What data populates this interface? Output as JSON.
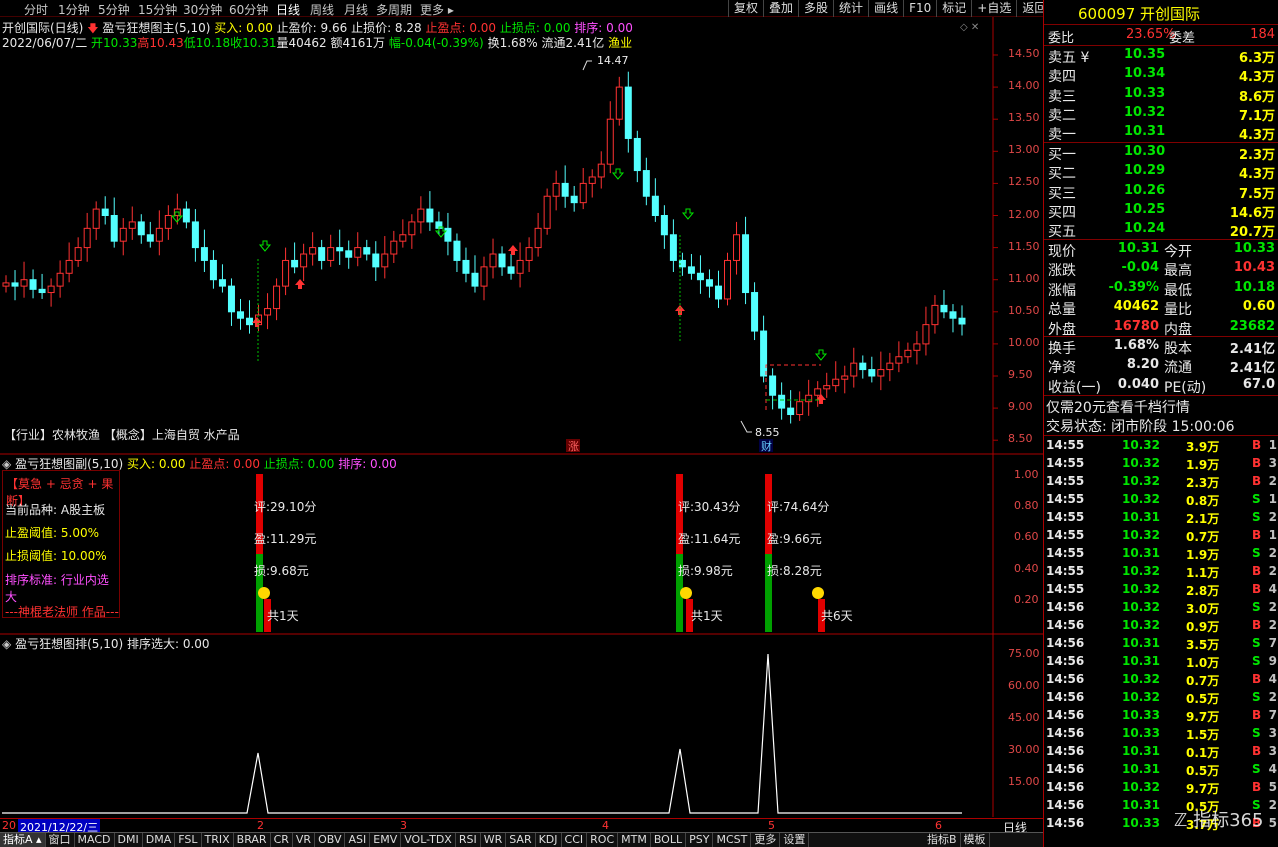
{
  "topbar": {
    "periods": [
      "分时",
      "1分钟",
      "5分钟",
      "15分钟",
      "30分钟",
      "60分钟",
      "日线",
      "周线",
      "月线",
      "多周期",
      "更多"
    ],
    "active": "日线",
    "right_buttons": [
      "复权",
      "叠加",
      "多股",
      "统计",
      "画线",
      "F10",
      "标记",
      "+自选",
      "返回"
    ]
  },
  "main_info": {
    "title": "开创国际(日线)",
    "indicator": "盈亏狂想图主(5,10)",
    "buy": "买入: 0.00",
    "take_profit_price": "止盈价: 9.66",
    "stop_loss_price": "止损价: 8.28",
    "take_profit_point": "止盈点: 0.00",
    "stop_loss_point": "止损点: 0.00",
    "rank": "排序: 0.00",
    "date": "2022/06/07/二",
    "open": "开10.33",
    "high": "高10.43",
    "low": "低10.18",
    "close": "收10.31",
    "volume": "量40462",
    "amount": "额4161万",
    "change": "幅-0.04(-0.39%)",
    "turnover": "换1.68%",
    "float": "流通2.41亿",
    "sector": "渔业",
    "industry_line": "【行业】农林牧渔 【概念】上海自贸 水产品",
    "max_label": "14.47",
    "min_label": "8.55",
    "mark_zhang": "涨",
    "mark_cai": "财"
  },
  "main_axis": [
    "14.50",
    "14.00",
    "13.50",
    "13.00",
    "12.50",
    "12.00",
    "11.50",
    "11.00",
    "10.50",
    "10.00",
    "9.50",
    "9.00",
    "8.50"
  ],
  "sub1": {
    "title": "盈亏狂想图副(5,10)",
    "buy": "买入: 0.00",
    "tp": "止盈点: 0.00",
    "sl": "止损点: 0.00",
    "rank": "排序: 0.00",
    "box_title": "【莫急 + 忌贪 + 果断】",
    "variety_label": "当前品种:",
    "variety_value": "A股主板",
    "tp_threshold_label": "止盈阈值:",
    "tp_threshold_value": "5.00%",
    "sl_threshold_label": "止损阈值:",
    "sl_threshold_value": "10.00%",
    "rank_std_label": "排序标准:",
    "rank_std_value": "行业内选大",
    "author": "---神棍老法师 作品---",
    "signals": [
      {
        "score": "评:29.10分",
        "profit": "盈:11.29元",
        "loss": "损:9.68元",
        "days": "共1天"
      },
      {
        "score": "评:30.43分",
        "profit": "盈:11.64元",
        "loss": "损:9.98元",
        "days": "共1天"
      },
      {
        "score": "评:74.64分",
        "profit": "盈:9.66元",
        "loss": "损:8.28元",
        "days": "共6天"
      }
    ],
    "axis": [
      "1.00",
      "0.80",
      "0.60",
      "0.40",
      "0.20"
    ]
  },
  "sub2": {
    "title": "盈亏狂想图排(5,10)",
    "rank": "排序选大: 0.00",
    "axis": [
      "75.00",
      "60.00",
      "45.00",
      "30.00",
      "15.00"
    ]
  },
  "xaxis": {
    "date_label": "2021/12/22/三",
    "prefix": "20",
    "months": [
      "2",
      "3",
      "4",
      "5",
      "6"
    ],
    "period": "日线"
  },
  "bottom_tabs": [
    "指标A",
    "窗口",
    "MACD",
    "DMI",
    "DMA",
    "FSL",
    "TRIX",
    "BRAR",
    "CR",
    "VR",
    "OBV",
    "ASI",
    "EMV",
    "VOL-TDX",
    "RSI",
    "WR",
    "SAR",
    "KDJ",
    "CCI",
    "ROC",
    "MTM",
    "BOLL",
    "PSY",
    "MCST",
    "更多",
    "设置"
  ],
  "bottom_right": [
    "指标B",
    "模板"
  ],
  "quote": {
    "code": "600097",
    "name": "开创国际",
    "weibi_label": "委比",
    "weibi": "23.65%",
    "weicha_label": "委差",
    "weicha": "184",
    "sells": [
      {
        "label": "卖五",
        "price": "10.35",
        "vol": "6.3万",
        "mark": "¥"
      },
      {
        "label": "卖四",
        "price": "10.34",
        "vol": "4.3万"
      },
      {
        "label": "卖三",
        "price": "10.33",
        "vol": "8.6万"
      },
      {
        "label": "卖二",
        "price": "10.32",
        "vol": "7.1万"
      },
      {
        "label": "卖一",
        "price": "10.31",
        "vol": "4.3万"
      }
    ],
    "buys": [
      {
        "label": "买一",
        "price": "10.30",
        "vol": "2.3万"
      },
      {
        "label": "买二",
        "price": "10.29",
        "vol": "4.3万"
      },
      {
        "label": "买三",
        "price": "10.26",
        "vol": "7.5万"
      },
      {
        "label": "买四",
        "price": "10.25",
        "vol": "14.6万"
      },
      {
        "label": "买五",
        "price": "10.24",
        "vol": "20.7万"
      }
    ],
    "stats1": [
      {
        "l": "现价",
        "v": "10.31",
        "l2": "今开",
        "v2": "10.33"
      },
      {
        "l": "涨跌",
        "v": "-0.04",
        "l2": "最高",
        "v2": "10.43"
      },
      {
        "l": "涨幅",
        "v": "-0.39%",
        "l2": "最低",
        "v2": "10.18"
      },
      {
        "l": "总量",
        "v": "40462",
        "l2": "量比",
        "v2": "0.60"
      },
      {
        "l": "外盘",
        "v": "16780",
        "l2": "内盘",
        "v2": "23682"
      }
    ],
    "stats2": [
      {
        "l": "换手",
        "v": "1.68%",
        "l2": "股本",
        "v2": "2.41亿"
      },
      {
        "l": "净资",
        "v": "8.20",
        "l2": "流通",
        "v2": "2.41亿"
      },
      {
        "l": "收益(一)",
        "v": "0.040",
        "l2": "PE(动)",
        "v2": "67.0"
      }
    ],
    "promo": "仅需20元查看千档行情",
    "trade_status": "交易状态: 闭市阶段 15:00:06",
    "ticks": [
      [
        "14:55",
        "10.32",
        "3.9万",
        "B",
        "1"
      ],
      [
        "14:55",
        "10.32",
        "1.9万",
        "B",
        "3"
      ],
      [
        "14:55",
        "10.32",
        "2.3万",
        "B",
        "2"
      ],
      [
        "14:55",
        "10.32",
        "0.8万",
        "S",
        "1"
      ],
      [
        "14:55",
        "10.31",
        "2.1万",
        "S",
        "2"
      ],
      [
        "14:55",
        "10.32",
        "0.7万",
        "B",
        "1"
      ],
      [
        "14:55",
        "10.31",
        "1.9万",
        "S",
        "2"
      ],
      [
        "14:55",
        "10.32",
        "1.1万",
        "B",
        "2"
      ],
      [
        "14:55",
        "10.32",
        "2.8万",
        "B",
        "4"
      ],
      [
        "14:56",
        "10.32",
        "3.0万",
        "S",
        "2"
      ],
      [
        "14:56",
        "10.32",
        "0.9万",
        "B",
        "2"
      ],
      [
        "14:56",
        "10.31",
        "3.5万",
        "S",
        "7"
      ],
      [
        "14:56",
        "10.31",
        "1.0万",
        "S",
        "9"
      ],
      [
        "14:56",
        "10.32",
        "0.7万",
        "B",
        "4"
      ],
      [
        "14:56",
        "10.32",
        "0.5万",
        "S",
        "2"
      ],
      [
        "14:56",
        "10.33",
        "9.7万",
        "B",
        "7"
      ],
      [
        "14:56",
        "10.33",
        "1.5万",
        "S",
        "3"
      ],
      [
        "14:56",
        "10.31",
        "0.1万",
        "B",
        "3"
      ],
      [
        "14:56",
        "10.31",
        "0.5万",
        "S",
        "4"
      ],
      [
        "14:56",
        "10.32",
        "9.7万",
        "B",
        "5"
      ],
      [
        "14:56",
        "10.31",
        "0.5万",
        "S",
        "2"
      ],
      [
        "14:56",
        "10.33",
        "3.7万",
        "B",
        "5"
      ]
    ],
    "watermark": "指标365"
  }
}
